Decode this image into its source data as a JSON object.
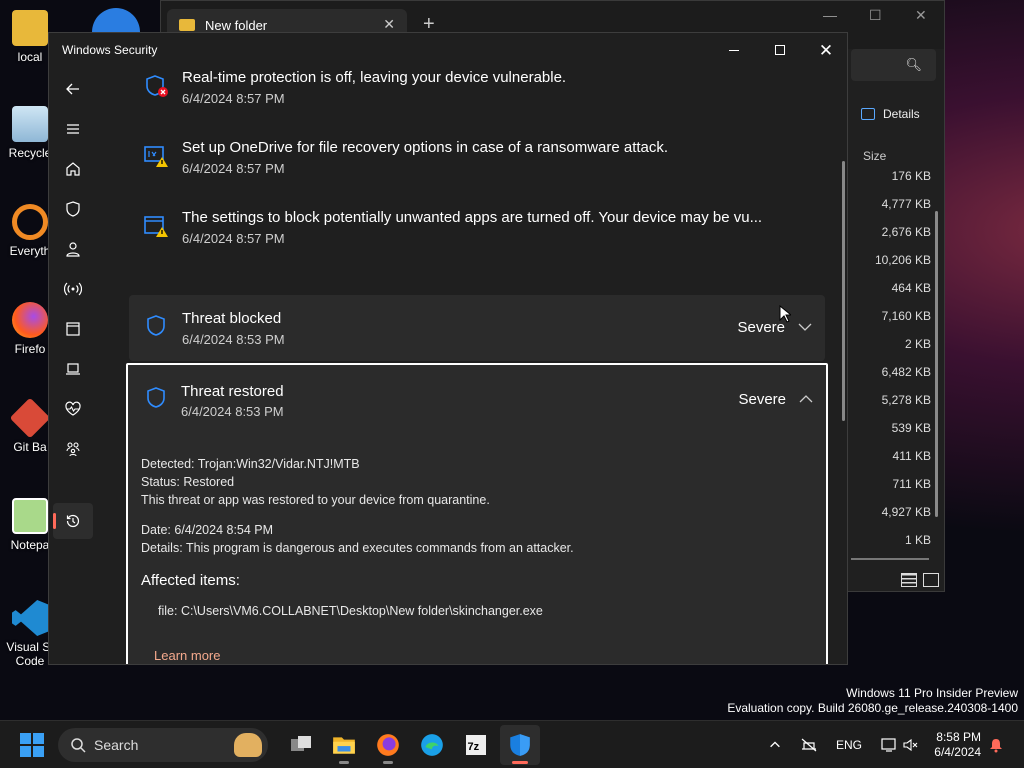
{
  "desktop": {
    "icons": [
      {
        "label": "local"
      },
      {
        "label": "Recycle"
      },
      {
        "label": "Everyth"
      },
      {
        "label": "Firefo"
      },
      {
        "label": "Git Ba"
      },
      {
        "label": "Notepa"
      },
      {
        "label": "Visual St"
      },
      {
        "label": "Code"
      }
    ]
  },
  "explorer": {
    "tab_title": "New folder",
    "details_label": "Details",
    "size_header": "Size",
    "sizes": [
      "176 KB",
      "4,777 KB",
      "2,676 KB",
      "10,206 KB",
      "464 KB",
      "7,160 KB",
      "2 KB",
      "6,482 KB",
      "5,278 KB",
      "539 KB",
      "411 KB",
      "711 KB",
      "4,927 KB",
      "1 KB"
    ]
  },
  "security": {
    "window_title": "Windows Security",
    "history": [
      {
        "title": "Real-time protection is off, leaving your device vulnerable.",
        "date": "6/4/2024 8:57 PM"
      },
      {
        "title": "Set up OneDrive for file recovery options in case of a ransomware attack.",
        "date": "6/4/2024 8:57 PM"
      },
      {
        "title": "The settings to block potentially unwanted apps are turned off. Your device may be vu...",
        "date": "6/4/2024 8:57 PM"
      },
      {
        "title": "Threat blocked",
        "date": "6/4/2024 8:53 PM",
        "severity": "Severe"
      }
    ],
    "expanded": {
      "title": "Threat restored",
      "date": "6/4/2024 8:53 PM",
      "severity": "Severe",
      "detected_label": "Detected:",
      "detected_value": "Trojan:Win32/Vidar.NTJ!MTB",
      "status_label": "Status:",
      "status_value": "Restored",
      "status_note": "This threat or app was restored to your device from quarantine.",
      "date_label": "Date:",
      "date_value": "6/4/2024 8:54 PM",
      "details_label": "Details:",
      "details_value": "This program is dangerous and executes commands from an attacker.",
      "affected_heading": "Affected items:",
      "file_label": "file:",
      "file_path": "C:\\Users\\VM6.COLLABNET\\Desktop\\New folder\\skinchanger.exe",
      "learn_more": "Learn more"
    }
  },
  "watermark": {
    "line1": "Windows 11 Pro Insider Preview",
    "line2": "Evaluation copy. Build 26080.ge_release.240308-1400"
  },
  "taskbar": {
    "search_label": "Search",
    "language": "ENG",
    "time": "8:58 PM",
    "date": "6/4/2024"
  },
  "colors": {
    "accent_active": "#ff6a5a",
    "shield_blue": "#2f8cff",
    "warning_yellow": "#f5c400",
    "error_red": "#e81123",
    "learn_more": "#f4a98d"
  }
}
